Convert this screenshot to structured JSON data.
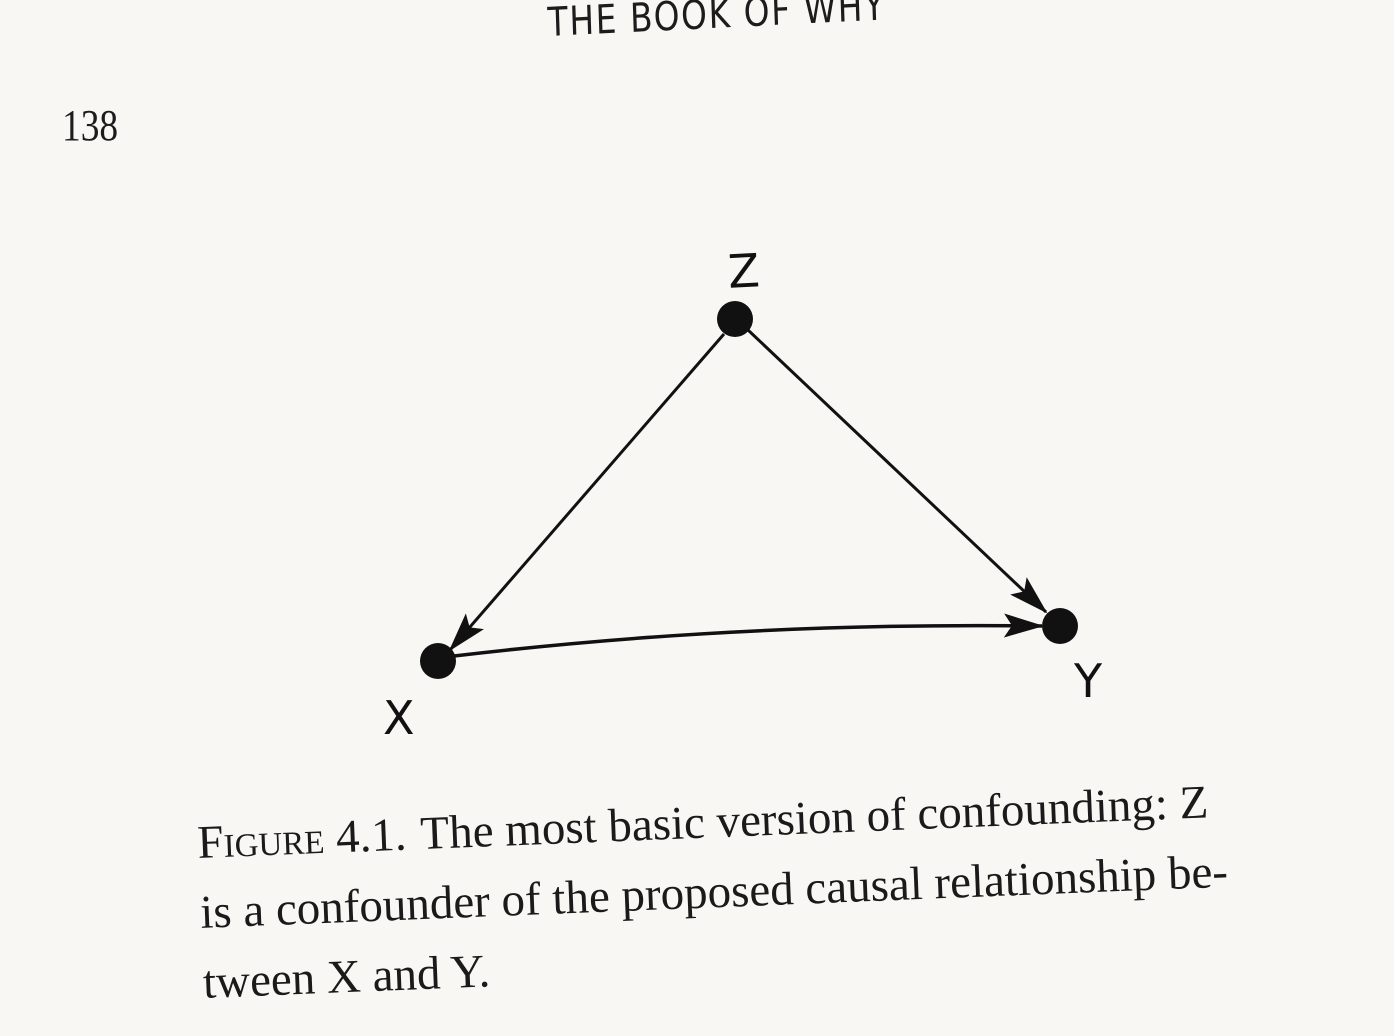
{
  "running_head": "THE BOOK OF WHY",
  "page_number": "138",
  "diagram": {
    "nodes": [
      {
        "id": "Z",
        "label": "Z"
      },
      {
        "id": "X",
        "label": "X"
      },
      {
        "id": "Y",
        "label": "Y"
      }
    ],
    "edges": [
      {
        "from": "Z",
        "to": "X"
      },
      {
        "from": "Z",
        "to": "Y"
      },
      {
        "from": "X",
        "to": "Y"
      }
    ]
  },
  "caption": {
    "figure_label": "Figure 4.1.",
    "lines": [
      "The most basic version of confounding: Z",
      "is a confounder of the proposed causal relationship be-",
      "tween X and Y."
    ]
  }
}
